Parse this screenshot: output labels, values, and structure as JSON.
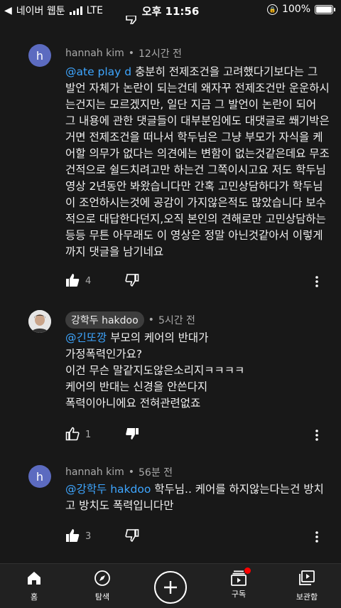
{
  "status_bar": {
    "carrier": "네이버 웹툰",
    "network": "LTE",
    "time": "오후 11:56",
    "battery": "100%"
  },
  "comments": [
    {
      "author": "hannah kim",
      "avatar_letter": "h",
      "time": "12시간 전",
      "mention": "@ate play d",
      "text": " 충분히 전제조건을 고려했다기보다는 그 발언 자체가 논란이 되는건데 왜자꾸 전제조건만 운운하시는건지는 모르겠지만, 일단 지금 그 발언이 논란이 되어 그 내용에 관한 댓글들이 대부분임에도 대댓글로 쐐기박은거면 전제조건을 떠나서 학두님은 그냥 부모가 자식을 케어할 의무가 없다는 의견에는 변함이 없는것같은데요 무조건적으로 쉴드치려고만 하는건 그쪽이시고요 저도 학두님 영상 2년동안 봐왔습니다만 간혹 고민상담하다가 학두님이 조언하시는것에 공감이 가지않은적도 많았습니다 보수적으로 대답한다던지,오직 본인의 견해로만 고민상담하는 등등 무튼 아무래도 이 영상은 정말 아닌것같아서 이렇게까지 댓글을 남기네요",
      "likes": "4"
    },
    {
      "author": "강학두 hakdoo",
      "time": "5시간 전",
      "mention": "@긴또깡",
      "lines": [
        " 부모의 케어의 반대가",
        "가정폭력인가요?",
        "이건 무슨 말같지도않은소리지ㅋㅋㅋㅋ",
        "케어의 반대는 신경을 안쓴다지",
        "폭력이아니에요 전혀관련없죠"
      ],
      "likes": "1"
    },
    {
      "author": "hannah kim",
      "avatar_letter": "h",
      "time": "56분 전",
      "mention": "@강학두 hakdoo",
      "text": " 학두님.. 케어를 하지않는다는건 방치고 방치도 폭력입니다만",
      "likes": "3"
    }
  ],
  "bottom_nav": {
    "home": "홈",
    "explore": "탐색",
    "subscriptions": "구독",
    "library": "보관함"
  },
  "colors": {
    "background": "#181818",
    "mention": "#3ea6ff",
    "avatar": "#5c6bc0",
    "notification_dot": "#ff0000"
  }
}
